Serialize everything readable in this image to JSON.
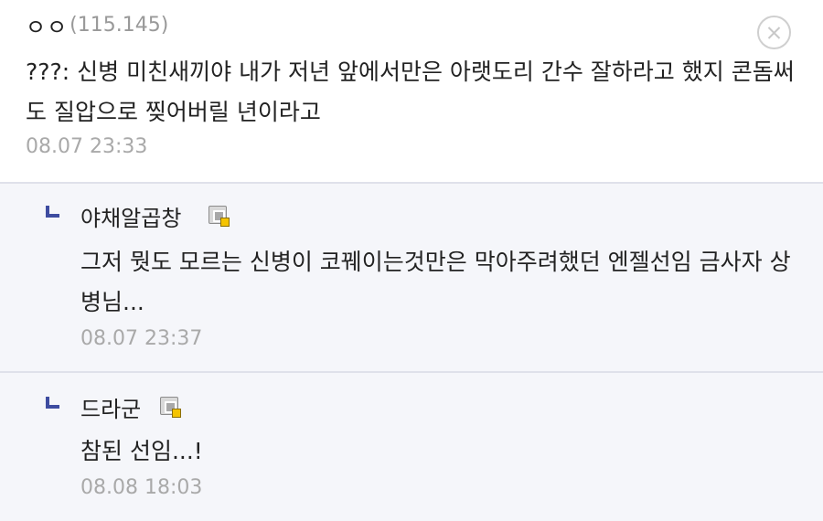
{
  "comment": {
    "nickname": "ㅇㅇ",
    "ip": "(115.145)",
    "text": "???: 신병 미친새끼야 내가 저년 앞에서만은 아랫도리 간수 잘하라고 했지 콘돔써도 질압으로 찢어버릴 년이라고",
    "date": "08.07 23:33",
    "delete_icon": "close-circle-icon"
  },
  "replies": [
    {
      "nickname": "야채알곱창",
      "badge_icon": "gallog-icon",
      "text": "그저 뭣도 모르는 신병이 코꿰이는것만은 막아주려했던 엔젤선임 금사자 상병님...",
      "date": "08.07 23:37"
    },
    {
      "nickname": "드라군",
      "badge_icon": "gallog-icon",
      "text": "참된 선임...!",
      "date": "08.08 18:03"
    }
  ],
  "colors": {
    "reply_background": "#f5f6fa",
    "reply_marker": "#3e4ca0",
    "meta_text": "#a9a9a9",
    "divider": "#dfe1ea"
  }
}
